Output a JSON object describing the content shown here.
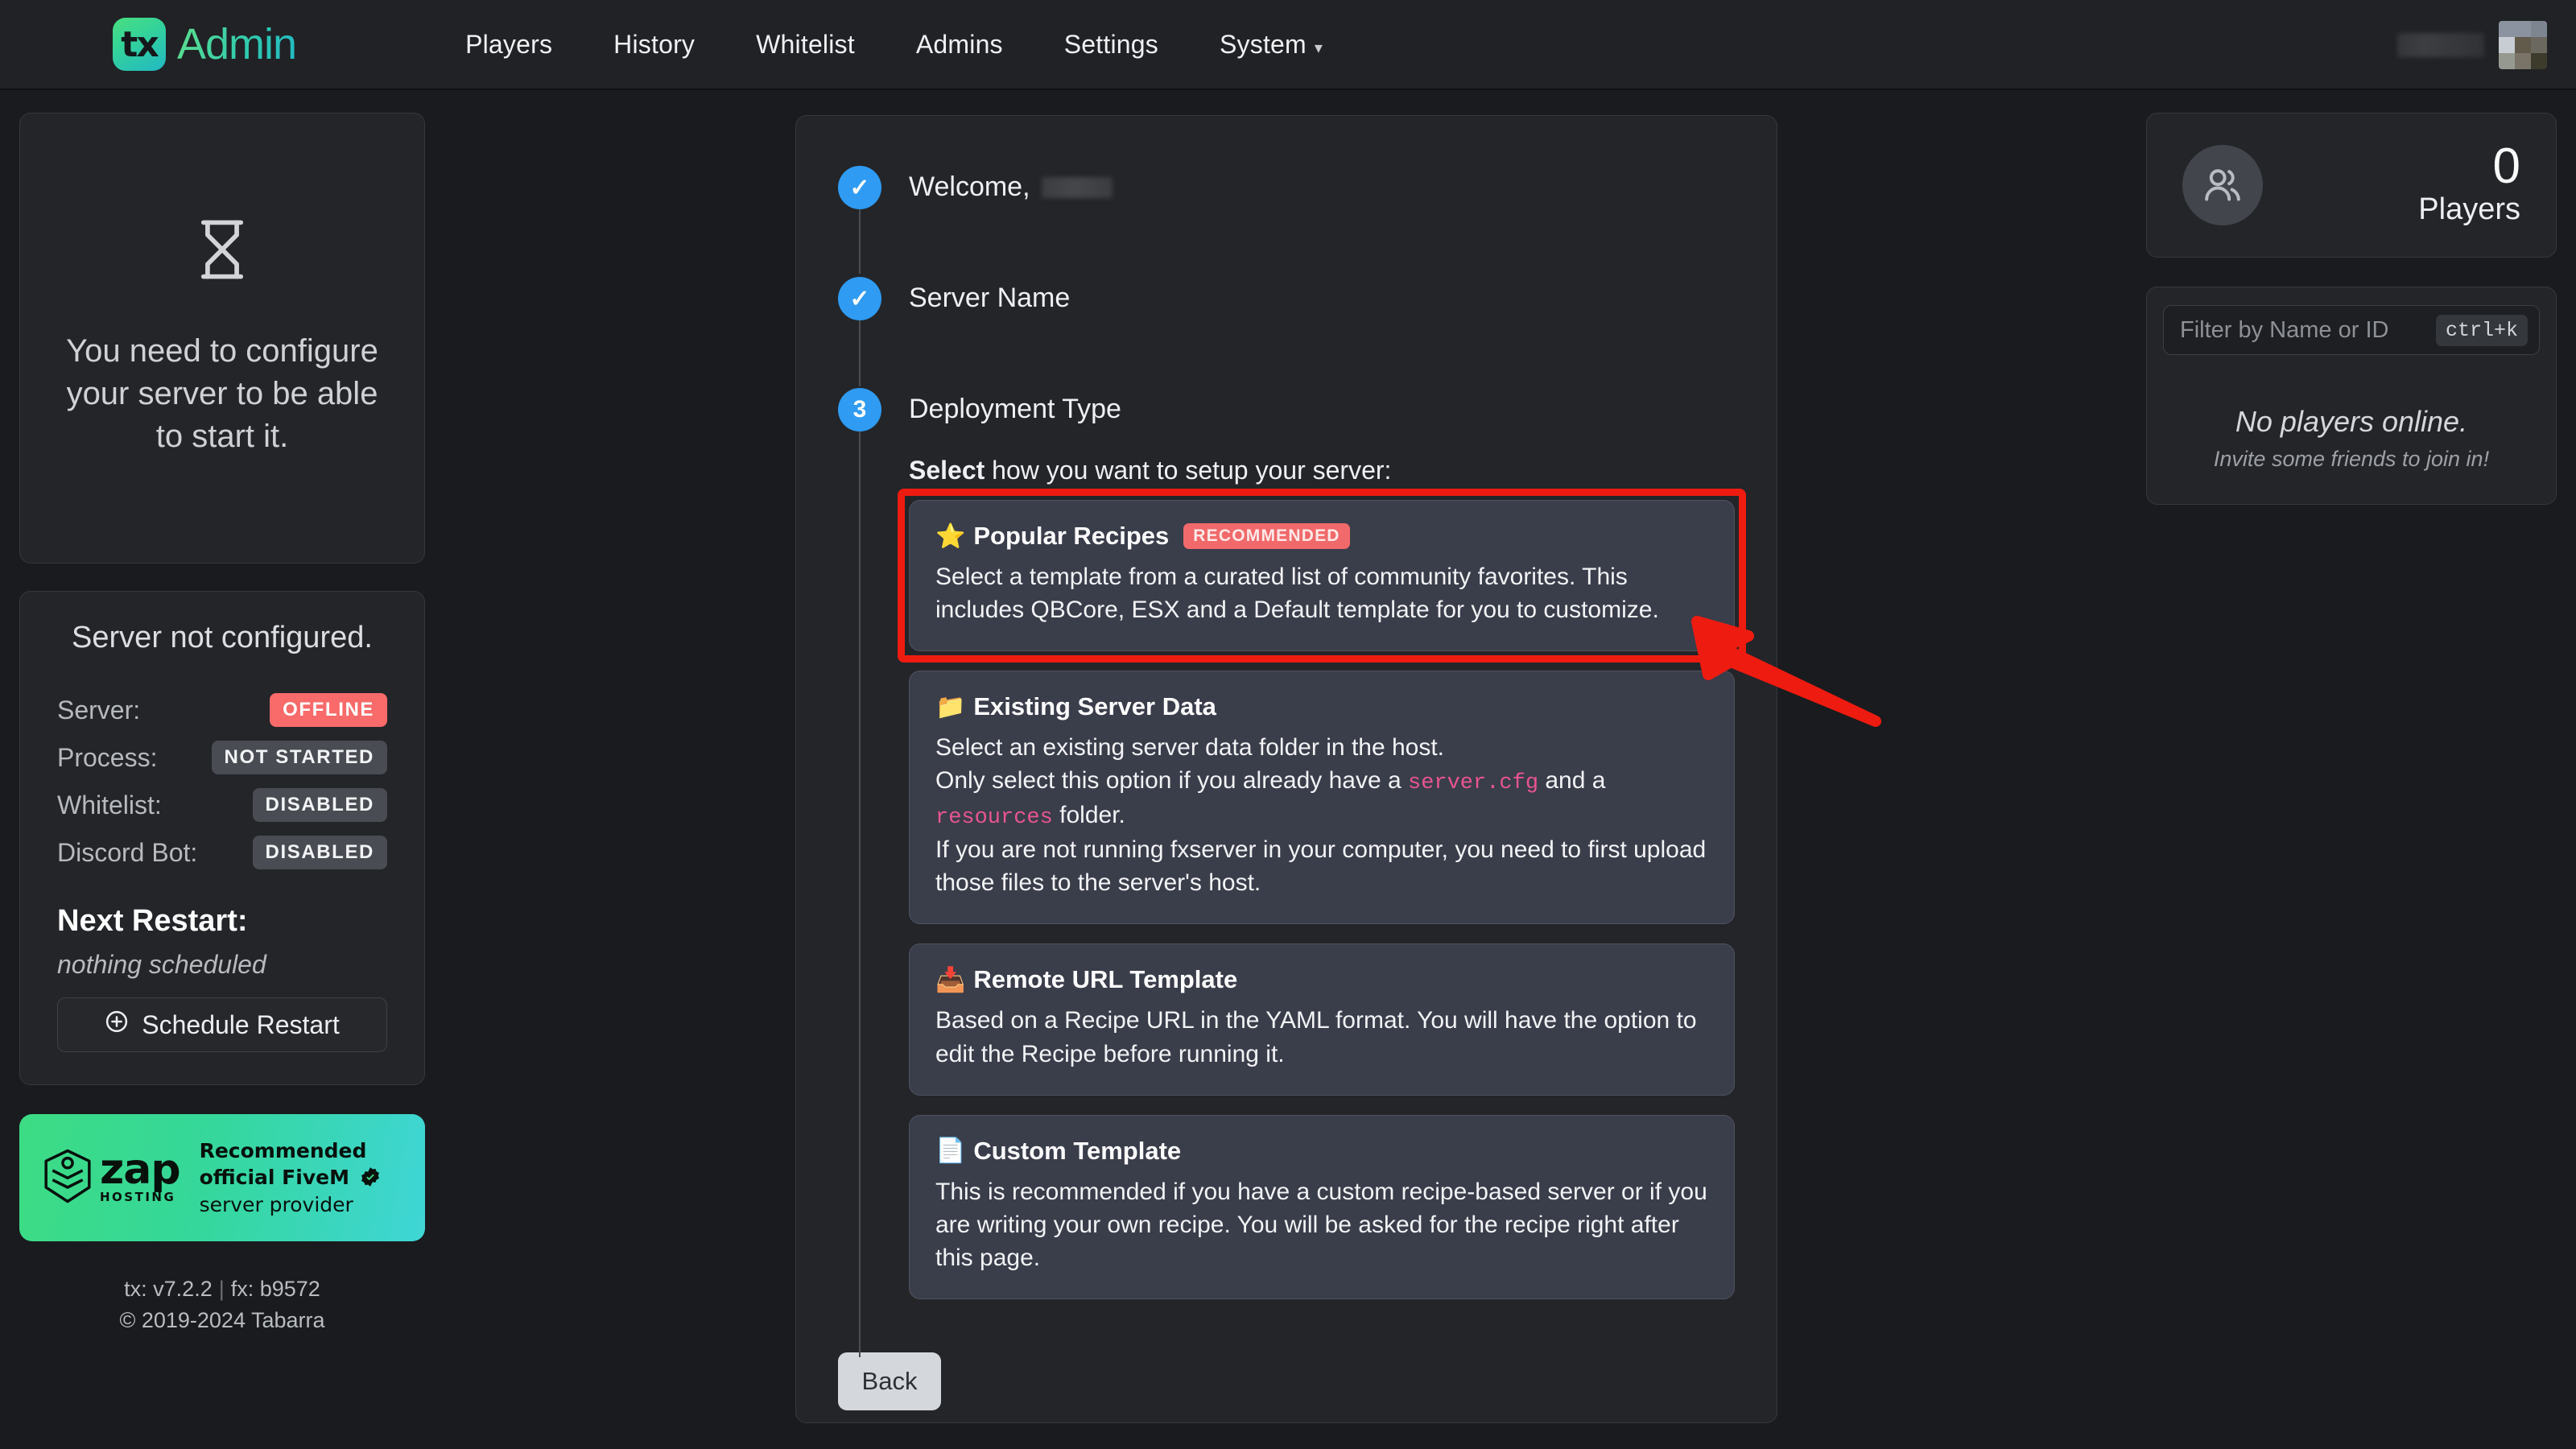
{
  "header": {
    "brand_mark": "tx",
    "brand_name": "Admin",
    "nav": [
      {
        "label": "Players",
        "icon": null
      },
      {
        "label": "History",
        "icon": null
      },
      {
        "label": "Whitelist",
        "icon": null
      },
      {
        "label": "Admins",
        "icon": null
      },
      {
        "label": "Settings",
        "icon": null
      },
      {
        "label": "System",
        "icon": "chevron-down-icon"
      }
    ],
    "system_chevron": "⌄",
    "account_name_redacted": "",
    "avatar_alt": "user-avatar"
  },
  "left": {
    "configure": {
      "icon": "hourglass-icon",
      "message": "You need to configure your server to be able to start it."
    },
    "status": {
      "title": "Server not configured.",
      "rows": [
        {
          "label": "Server:",
          "value": "OFFLINE",
          "style": "offline"
        },
        {
          "label": "Process:",
          "value": "NOT STARTED",
          "style": "muted"
        },
        {
          "label": "Whitelist:",
          "value": "DISABLED",
          "style": "muted"
        },
        {
          "label": "Discord Bot:",
          "value": "DISABLED",
          "style": "muted"
        }
      ],
      "next_restart_title": "Next Restart:",
      "next_restart_value": "nothing scheduled",
      "schedule_button": "Schedule Restart",
      "schedule_icon": "plus-circle-icon"
    },
    "banner": {
      "brand": "zap",
      "brand_sub": "HOSTING",
      "line1_bold": "Recommended",
      "line2_bold": "official FiveM",
      "line3": "server provider",
      "verified_icon": "verified-check-icon"
    },
    "footer": {
      "tx_version": "tx: v7.2.2",
      "separator": "|",
      "fx_version": "fx: b9572",
      "copyright": "© 2019-2024 Tabarra"
    }
  },
  "main": {
    "steps": [
      {
        "marker": "✓",
        "label": "Welcome,",
        "state": "complete",
        "has_redacted_name": true
      },
      {
        "marker": "✓",
        "label": "Server Name",
        "state": "complete",
        "has_redacted_name": false
      },
      {
        "marker": "3",
        "label": "Deployment Type",
        "state": "active",
        "has_redacted_name": false
      }
    ],
    "select_prompt_bold": "Select",
    "select_prompt_rest": " how you want to setup your server:",
    "options": [
      {
        "emoji": "⭐",
        "icon": "star-icon",
        "title": "Popular Recipes",
        "badge": "RECOMMENDED",
        "desc": "Select a template from a curated list of community favorites. This includes QBCore, ESX and a Default template for you to customize.",
        "highlighted": true
      },
      {
        "emoji": "📁",
        "icon": "folder-icon",
        "title": "Existing Server Data",
        "badge": null,
        "desc_parts": [
          {
            "t": "Select an existing server data folder in the host.",
            "code": false,
            "br": true
          },
          {
            "t": "Only select this option if you already have a ",
            "code": false,
            "br": false
          },
          {
            "t": "server.cfg",
            "code": true,
            "br": false
          },
          {
            "t": " and a ",
            "code": false,
            "br": false
          },
          {
            "t": "resources",
            "code": true,
            "br": false
          },
          {
            "t": " folder.",
            "code": false,
            "br": true
          },
          {
            "t": "If you are not running fxserver in your computer, you need to first upload those files to the server's host.",
            "code": false,
            "br": false
          }
        ],
        "highlighted": false
      },
      {
        "emoji": "📥",
        "icon": "inbox-download-icon",
        "title": "Remote URL Template",
        "badge": null,
        "desc": "Based on a Recipe URL in the YAML format. You will have the option to edit the Recipe before running it.",
        "highlighted": false
      },
      {
        "emoji": "📄",
        "icon": "document-icon",
        "title": "Custom Template",
        "badge": null,
        "desc": "This is recommended if you have a custom recipe-based server or if you are writing your own recipe. You will be asked for the recipe right after this page.",
        "highlighted": false
      }
    ],
    "back_button": "Back"
  },
  "right": {
    "players": {
      "icon": "players-group-icon",
      "count": "0",
      "label": "Players"
    },
    "filter": {
      "placeholder": "Filter by Name or ID",
      "value": "",
      "shortcut": "ctrl+k"
    },
    "empty": {
      "title": "No players online.",
      "subtitle": "Invite some friends to join in!"
    }
  },
  "annotation": {
    "highlight_color": "#ee1b10",
    "arrow_color": "#ee1b10",
    "target": "Popular Recipes"
  }
}
